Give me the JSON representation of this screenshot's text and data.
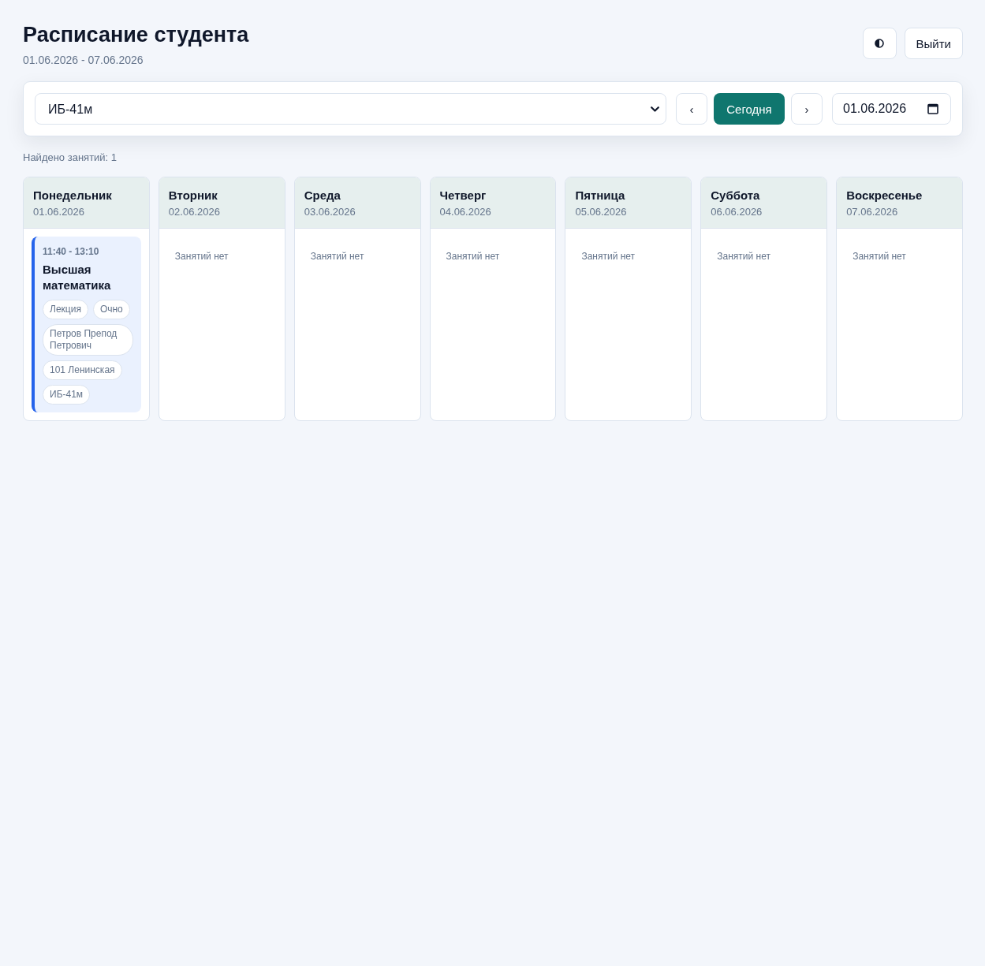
{
  "header": {
    "title": "Расписание студента",
    "range": "01.06.2026 - 07.06.2026"
  },
  "header_actions": [
    {
      "kind": "theme-toggle"
    },
    {
      "kind": "logout",
      "label": "Выйти"
    }
  ],
  "toolbar": {
    "group_select": {
      "value": "ИБ-41м"
    },
    "prev_button": {
      "label": "‹"
    },
    "today_button": {
      "label": "Сегодня"
    },
    "next_button": {
      "label": "›"
    },
    "date_field": {
      "value": "01.06.2026"
    }
  },
  "found_text": "Найдено занятий: 1",
  "days": [
    {
      "name": "Понедельник",
      "date": "01.06.2026",
      "lessons": [
        {
          "time": "11:40 - 13:10",
          "title": "Высшая математика",
          "tags": [
            "Лекция",
            "Очно",
            "Петров Препод Петрович",
            "101 Ленинская",
            "ИБ-41м"
          ]
        }
      ]
    },
    {
      "name": "Вторник",
      "date": "02.06.2026",
      "empty_text": "Занятий нет"
    },
    {
      "name": "Среда",
      "date": "03.06.2026",
      "empty_text": "Занятий нет"
    },
    {
      "name": "Четверг",
      "date": "04.06.2026",
      "empty_text": "Занятий нет"
    },
    {
      "name": "Пятница",
      "date": "05.06.2026",
      "empty_text": "Занятий нет"
    },
    {
      "name": "Суббота",
      "date": "06.06.2026",
      "empty_text": "Занятий нет"
    },
    {
      "name": "Воскресенье",
      "date": "07.06.2026",
      "empty_text": "Занятий нет"
    }
  ]
}
